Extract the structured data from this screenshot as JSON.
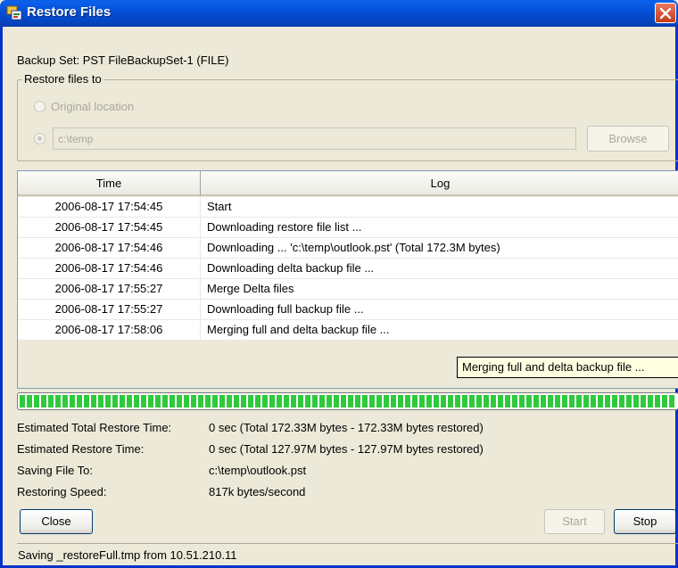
{
  "window": {
    "title": "Restore Files"
  },
  "backup_set_text": "Backup Set: PST FileBackupSet-1 (FILE)",
  "restore_group": {
    "title": "Restore files to",
    "option_original": "Original location",
    "path_value": "c:\\temp",
    "browse_label": "Browse"
  },
  "table": {
    "columns": [
      "Time",
      "Log"
    ],
    "rows": [
      {
        "time": "2006-08-17 17:54:45",
        "log": "Start"
      },
      {
        "time": "2006-08-17 17:54:45",
        "log": "Downloading restore file list ..."
      },
      {
        "time": "2006-08-17 17:54:46",
        "log": "Downloading ... 'c:\\temp\\outlook.pst' (Total 172.3M bytes)"
      },
      {
        "time": "2006-08-17 17:54:46",
        "log": "Downloading delta backup file ..."
      },
      {
        "time": "2006-08-17 17:55:27",
        "log": "Merge Delta files"
      },
      {
        "time": "2006-08-17 17:55:27",
        "log": "Downloading full backup file ..."
      },
      {
        "time": "2006-08-17 17:58:06",
        "log": "Merging full and delta backup file ..."
      }
    ]
  },
  "tooltip": "Merging full and delta backup file ...",
  "progress": {
    "fraction": 1.0,
    "color": "#2fc93c"
  },
  "info": {
    "total_time_label": "Estimated Total Restore Time:",
    "total_time_value": "0 sec (Total 172.33M bytes - 172.33M bytes restored)",
    "restore_time_label": "Estimated Restore Time:",
    "restore_time_value": "0 sec (Total 127.97M bytes - 127.97M bytes restored)",
    "saving_label": "Saving File To:",
    "saving_value": "c:\\temp\\outlook.pst",
    "speed_label": "Restoring Speed:",
    "speed_value": "817k bytes/second"
  },
  "buttons": {
    "close": "Close",
    "start": "Start",
    "stop": "Stop"
  },
  "status": "Saving _restoreFull.tmp from 10.51.210.11"
}
